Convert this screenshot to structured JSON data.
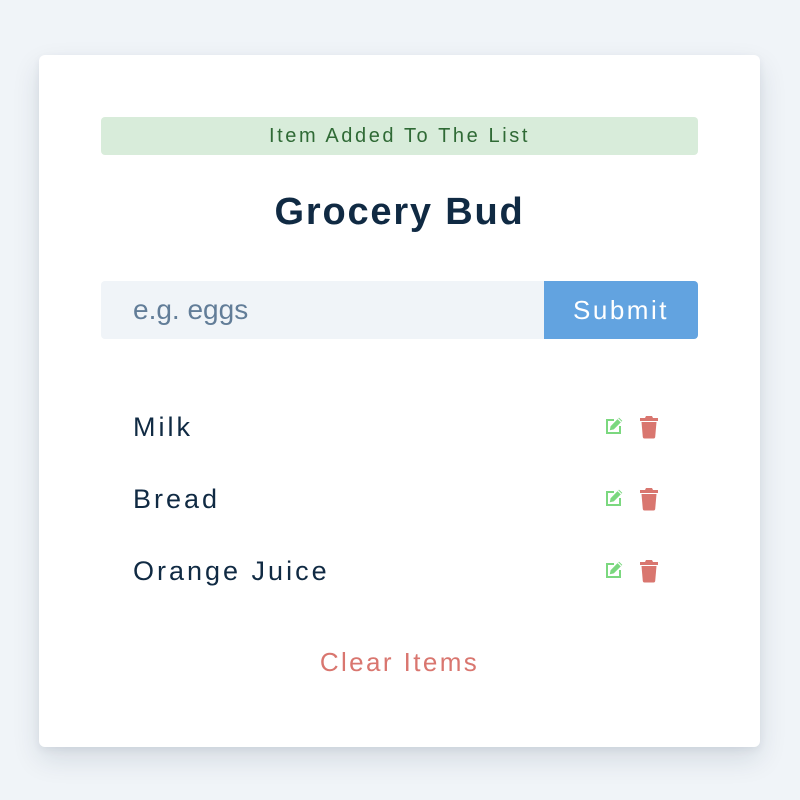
{
  "alert": {
    "text": "Item Added To The List",
    "type": "success"
  },
  "header": {
    "title": "Grocery Bud"
  },
  "form": {
    "input_value": "",
    "input_placeholder": "e.g. eggs",
    "submit_label": "Submit"
  },
  "items": [
    {
      "label": "Milk",
      "edit_icon": "edit-icon",
      "delete_icon": "trash-icon"
    },
    {
      "label": "Bread",
      "edit_icon": "edit-icon",
      "delete_icon": "trash-icon"
    },
    {
      "label": "Orange Juice",
      "edit_icon": "edit-icon",
      "delete_icon": "trash-icon"
    }
  ],
  "actions": {
    "clear_label": "Clear Items"
  },
  "colors": {
    "page_background": "#f0f4f8",
    "card_background": "#ffffff",
    "alert_background": "#d8ecda",
    "alert_text": "#2f6a35",
    "title_text": "#102a43",
    "input_background": "#f0f4f8",
    "placeholder_text": "#627d98",
    "submit_background": "#62a3e0",
    "edit_icon": "#7bd87f",
    "delete_icon": "#d9766f",
    "clear_text": "#d9766f"
  }
}
